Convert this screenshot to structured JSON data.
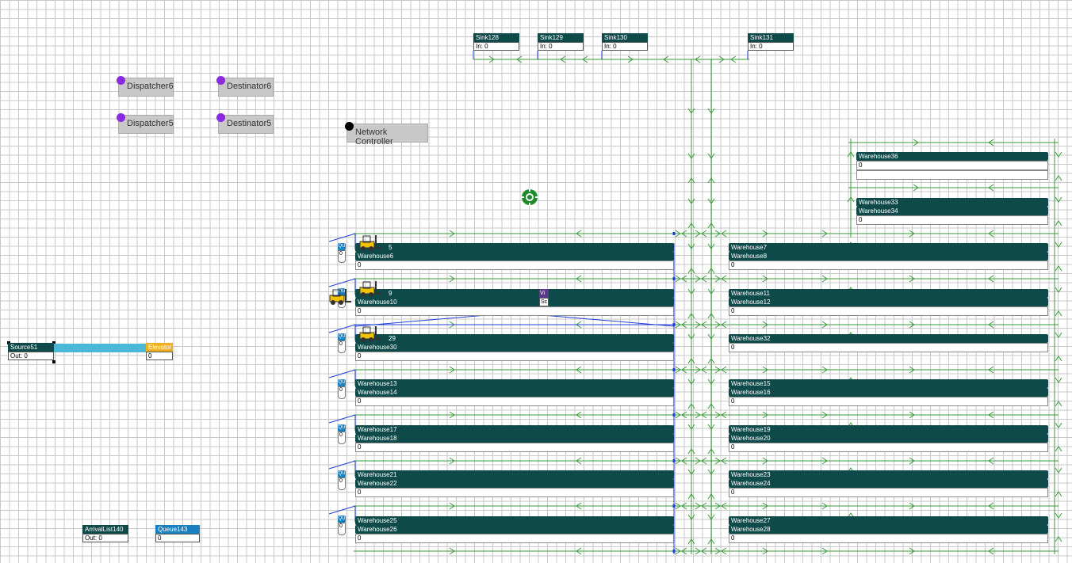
{
  "sinks": [
    {
      "name": "Sink128",
      "stat": "In: 0"
    },
    {
      "name": "Sink129",
      "stat": "In: 0"
    },
    {
      "name": "Sink130",
      "stat": "In: 0"
    },
    {
      "name": "Sink131",
      "stat": "In: 0"
    }
  ],
  "objects": {
    "dispatcher_a": "Dispatcher6",
    "destinator_a": "Destinator6",
    "dispatcher_b": "Dispatcher5",
    "destinator_b": "Destinator5",
    "network_controller": "Network Controller"
  },
  "source": {
    "name": "Source51",
    "stat": "Out: 0"
  },
  "elevator": {
    "name": "Elevator",
    "stat": "0"
  },
  "arrival_list": {
    "name": "ArrivalList140",
    "stat": "Out: 0"
  },
  "queue": {
    "name": "Queue143",
    "stat": "0"
  },
  "queue_stubs": [
    {
      "label": "QU",
      "val": "0"
    },
    {
      "label": "QU",
      "val": "0"
    },
    {
      "label": "QU",
      "val": "0"
    },
    {
      "label": "QU",
      "val": "0"
    },
    {
      "label": "QU",
      "val": "0"
    },
    {
      "label": "QU",
      "val": "0"
    },
    {
      "label": "QU",
      "val": "0"
    }
  ],
  "warehouses_left": [
    {
      "top": "5",
      "bottom": "Warehouse6",
      "count": "0"
    },
    {
      "top": "9",
      "bottom": "Warehouse10",
      "count": "0"
    },
    {
      "top": "29",
      "bottom": "Warehouse30",
      "count": "0"
    },
    {
      "top": "Warehouse13",
      "bottom": "Warehouse14",
      "count": "0"
    },
    {
      "top": "Warehouse17",
      "bottom": "Warehouse18",
      "count": "0"
    },
    {
      "top": "Warehouse21",
      "bottom": "Warehouse22",
      "count": "0"
    },
    {
      "top": "Warehouse25",
      "bottom": "Warehouse26",
      "count": "0"
    }
  ],
  "warehouses_right": [
    {
      "top": "Warehouse7",
      "bottom": "Warehouse8",
      "count": "0"
    },
    {
      "top": "Warehouse11",
      "bottom": "Warehouse12",
      "count": "0"
    },
    {
      "top": "Warehouse32",
      "bottom": "",
      "count": "0"
    },
    {
      "top": "Warehouse15",
      "bottom": "Warehouse16",
      "count": "0"
    },
    {
      "top": "Warehouse19",
      "bottom": "Warehouse20",
      "count": "0"
    },
    {
      "top": "Warehouse23",
      "bottom": "Warehouse24",
      "count": "0"
    },
    {
      "top": "Warehouse27",
      "bottom": "Warehouse28",
      "count": "0"
    }
  ],
  "warehouses_upper": [
    {
      "top": "Warehouse36",
      "bottom": "",
      "count": "0"
    },
    {
      "top": "Warehouse33",
      "bottom": "Warehouse34",
      "count": "0"
    }
  ],
  "mini_tag": {
    "top": "Vi",
    "bottom": "Sc"
  },
  "colors": {
    "header": "#0e4a4a",
    "grid": "#c9c9c9",
    "network": "#3a9a3a",
    "wire": "#1f3fd8",
    "purple": "#8a2be2",
    "elevator": "#f0b020",
    "conveyor": "#4bb8d8"
  }
}
